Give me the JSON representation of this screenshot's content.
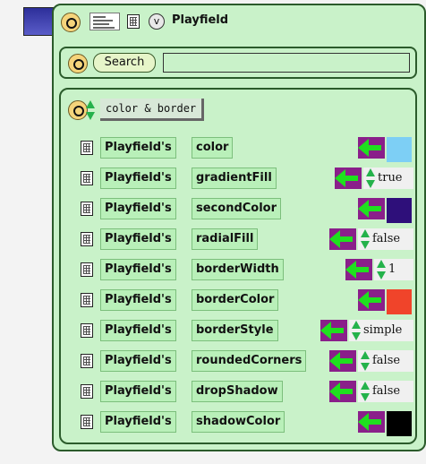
{
  "header": {
    "title": "Playfield",
    "view_button_label": "v"
  },
  "search": {
    "button_label": "Search",
    "input_value": ""
  },
  "category": {
    "label": "color & border"
  },
  "properties": [
    {
      "object": "Playfield's",
      "name": "color",
      "value_type": "color",
      "value": "#7dcff5"
    },
    {
      "object": "Playfield's",
      "name": "gradientFill",
      "value_type": "text",
      "value": "true"
    },
    {
      "object": "Playfield's",
      "name": "secondColor",
      "value_type": "color",
      "value": "#2e0f7a"
    },
    {
      "object": "Playfield's",
      "name": "radialFill",
      "value_type": "text",
      "value": "false"
    },
    {
      "object": "Playfield's",
      "name": "borderWidth",
      "value_type": "text",
      "value": "1"
    },
    {
      "object": "Playfield's",
      "name": "borderColor",
      "value_type": "color",
      "value": "#f0442a"
    },
    {
      "object": "Playfield's",
      "name": "borderStyle",
      "value_type": "text",
      "value": "simple"
    },
    {
      "object": "Playfield's",
      "name": "roundedCorners",
      "value_type": "text",
      "value": "false"
    },
    {
      "object": "Playfield's",
      "name": "dropShadow",
      "value_type": "text",
      "value": "false"
    },
    {
      "object": "Playfield's",
      "name": "shadowColor",
      "value_type": "color",
      "value": "#000000"
    }
  ],
  "colors": {
    "panel_bg": "#c9f2c9",
    "panel_border": "#2b5b2b",
    "setter_bg": "#8a1f8a",
    "setter_arrow": "#1fe01f",
    "top_swatch": "#3a3cb0"
  }
}
